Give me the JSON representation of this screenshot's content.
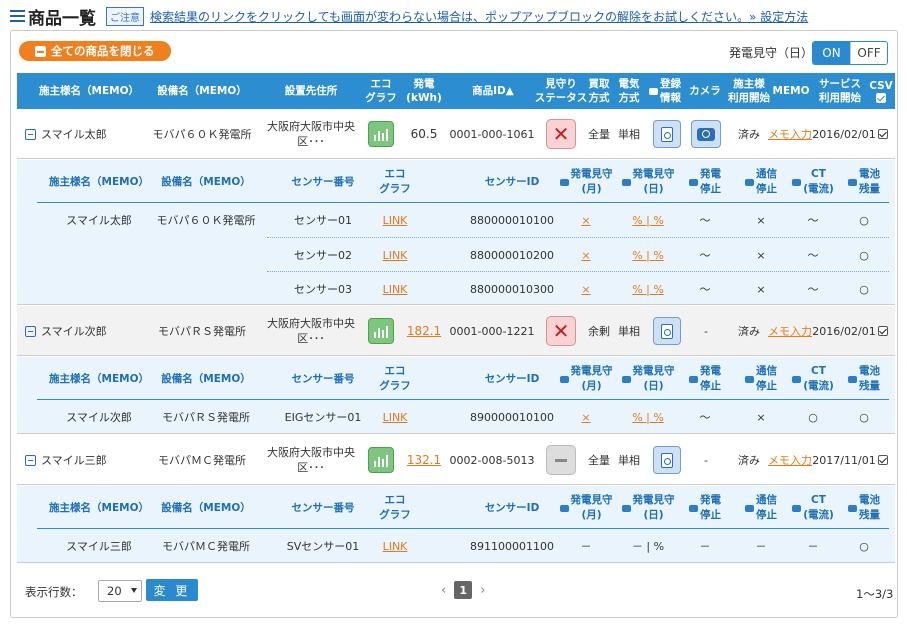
{
  "header": {
    "title": "商品一覧",
    "notice_badge": "ご注意",
    "notice_text": "検索結果のリンクをクリックしても画面が変わらない場合は、ポップアップブロックの解除をお試しください。» 設定方法"
  },
  "toolbar": {
    "close_all_label": "全ての商品を閉じる",
    "watch_label": "発電見守（日）",
    "on_label": "ON",
    "off_label": "OFF"
  },
  "table_headers": {
    "owner": "施主様名（MEMO）",
    "facility": "設備名（MEMO）",
    "address": "設置先住所",
    "eco_graph": "エコ\nグラフ",
    "generation": "発電\n(kWh)",
    "product_id": "商品ID▲",
    "watch_status": "見守り\nステータス",
    "purchase": "買取\n方式",
    "electric": "電気\n方式",
    "report": "登録\n情報",
    "camera": "カメラ",
    "owner_use": "施主様\n利用開始",
    "memo": "MEMO",
    "service_start": "サービス\n利用開始",
    "csv": "CSV"
  },
  "sub_headers": {
    "owner": "施主様名（MEMO）",
    "facility": "設備名（MEMO）",
    "sensor_no": "センサー番号",
    "eco_graph": "エコ\nグラフ",
    "sensor_id": "センサーID",
    "watch_month": "発電見守\n(月)",
    "watch_day": "発電見守\n(日)",
    "gen_stop": "発電\n停止",
    "comm_stop": "通信\n停止",
    "ct": "CT\n(電流)",
    "battery": "電池\n残量"
  },
  "products": [
    {
      "owner": "スマイル太郎",
      "facility": "モバパ６０Ｋ発電所",
      "address": "大阪府大阪市中央\n区･･･",
      "generation": "60.5",
      "product_id": "0001-000-1061",
      "purchase": "全量",
      "electric": "単相",
      "camera": "",
      "owner_use": "済み",
      "memo": "メモ入力",
      "service_start": "2016/02/01",
      "sensors": [
        {
          "owner": "スマイル太郎",
          "facility": "モバパ６０Ｋ発電所",
          "sensor_no": "センサー01",
          "eco": "LINK",
          "sensor_id": "880000010100",
          "month": "×",
          "day": "% | %",
          "gen_stop": "～",
          "comm_stop": "×",
          "ct": "～",
          "battery": "○"
        },
        {
          "owner": "",
          "facility": "",
          "sensor_no": "センサー02",
          "eco": "LINK",
          "sensor_id": "880000010200",
          "month": "×",
          "day": "% | %",
          "gen_stop": "～",
          "comm_stop": "×",
          "ct": "～",
          "battery": "○"
        },
        {
          "owner": "",
          "facility": "",
          "sensor_no": "センサー03",
          "eco": "LINK",
          "sensor_id": "880000010300",
          "month": "×",
          "day": "% | %",
          "gen_stop": "～",
          "comm_stop": "×",
          "ct": "～",
          "battery": "○"
        }
      ]
    },
    {
      "owner": "スマイル次郎",
      "facility": "モバパＲＳ発電所",
      "address": "大阪府大阪市中央\n区･･･",
      "generation": "182.1",
      "product_id": "0001-000-1221",
      "purchase": "余剰",
      "electric": "単相",
      "camera": "-",
      "owner_use": "済み",
      "memo": "メモ入力",
      "service_start": "2016/02/01",
      "sensors": [
        {
          "owner": "スマイル次郎",
          "facility": "モバパＲＳ発電所",
          "sensor_no": "EIGセンサー01",
          "eco": "LINK",
          "sensor_id": "890000010100",
          "month": "×",
          "day": "% | %",
          "gen_stop": "～",
          "comm_stop": "×",
          "ct": "○",
          "battery": "○"
        }
      ]
    },
    {
      "owner": "スマイル三郎",
      "facility": "モバパＭＣ発電所",
      "address": "大阪府大阪市中央\n区･･･",
      "generation": "132.1",
      "product_id": "0002-008-5013",
      "purchase": "全量",
      "electric": "単相",
      "camera": "-",
      "owner_use": "済み",
      "memo": "メモ入力",
      "service_start": "2017/11/01",
      "sensors": [
        {
          "owner": "スマイル三郎",
          "facility": "モバパＭＣ発電所",
          "sensor_no": "SVセンサー01",
          "eco": "LINK",
          "sensor_id": "891100001100",
          "month": "－",
          "day": "－ | %",
          "gen_stop": "－",
          "comm_stop": "－",
          "ct": "－",
          "battery": "○"
        }
      ]
    }
  ],
  "footer": {
    "rows_label": "表示行数：",
    "rows_value": "20",
    "change_label": "変 更",
    "prev": "‹",
    "page": "1",
    "next": "›",
    "count": "1～3/3"
  },
  "colors": {
    "accent": "#2c8dd1",
    "orange": "#f07f1e",
    "sub_bg": "#eaf4fc"
  }
}
